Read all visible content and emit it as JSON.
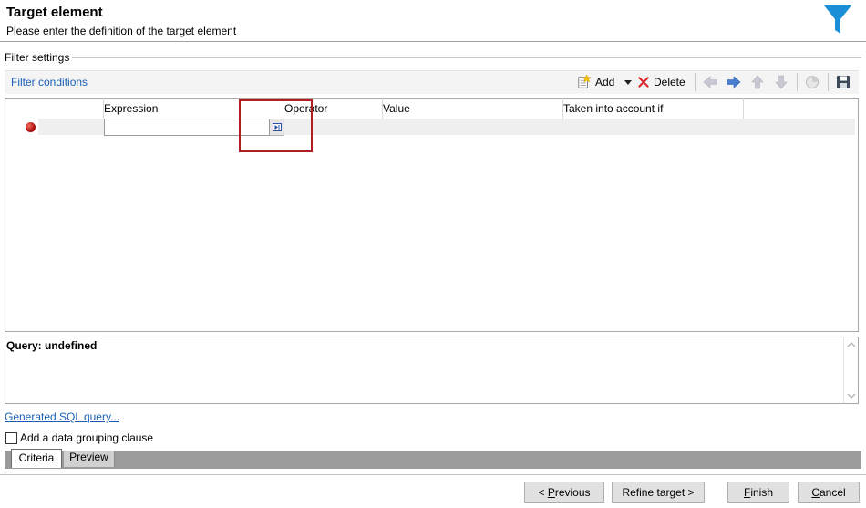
{
  "header": {
    "title": "Target element",
    "subtitle": "Please enter the definition of the target element",
    "icon": "filter-icon",
    "icon_color": "#1a8fd8"
  },
  "filter_settings": {
    "group_label": "Filter settings",
    "conditions_link": "Filter conditions",
    "toolbar": {
      "add_label": "Add",
      "delete_label": "Delete",
      "icons": [
        "add-icon",
        "dropdown-icon",
        "delete-icon",
        "move-left-icon",
        "move-right-icon",
        "move-up-icon",
        "move-down-icon",
        "refresh-icon",
        "save-icon"
      ]
    },
    "grid": {
      "columns": [
        "Expression",
        "Operator",
        "Value",
        "Taken into account if"
      ],
      "rows": [
        {
          "status": "red-dot",
          "expression": "",
          "operator": "",
          "value": "",
          "taken_into_account_if": ""
        }
      ]
    }
  },
  "query": {
    "label": "Query: undefined"
  },
  "sql_link": "Generated SQL query...",
  "grouping": {
    "label": "Add a data grouping clause",
    "checked": false
  },
  "tabs": {
    "criteria": "Criteria",
    "preview": "Preview",
    "active": "Criteria"
  },
  "buttons": {
    "previous": {
      "prefix": "< ",
      "key": "P",
      "rest": "revious"
    },
    "refine": "Refine target >",
    "finish": {
      "key": "F",
      "rest": "inish"
    },
    "cancel": {
      "key": "C",
      "rest": "ancel"
    }
  }
}
